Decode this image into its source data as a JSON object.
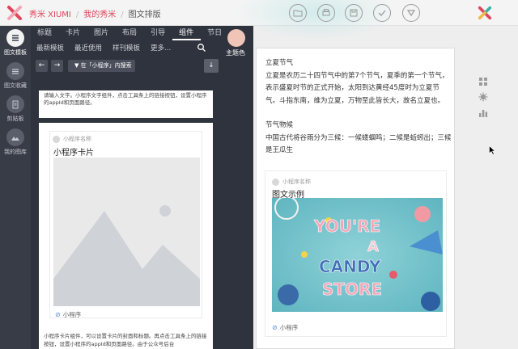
{
  "header": {
    "breadcrumbs": [
      "秀米 XIUMI",
      "我的秀米",
      "图文排版"
    ],
    "tools": [
      "folder-icon",
      "print-icon",
      "save-icon",
      "check-icon",
      "download-icon"
    ]
  },
  "left_nav": [
    {
      "label": "图文模板",
      "icon": "list-icon",
      "active": true
    },
    {
      "label": "图文收藏",
      "icon": "stack-icon",
      "active": false
    },
    {
      "label": "剪贴板",
      "icon": "clipboard-icon",
      "active": false
    },
    {
      "label": "我的图库",
      "icon": "image-icon",
      "active": false
    }
  ],
  "panel": {
    "tabs": [
      {
        "label": "标题",
        "active": false
      },
      {
        "label": "卡片",
        "active": false
      },
      {
        "label": "图片",
        "active": false
      },
      {
        "label": "布局",
        "active": false
      },
      {
        "label": "引导",
        "active": false
      },
      {
        "label": "组件",
        "active": true
      },
      {
        "label": "节日",
        "active": false
      }
    ],
    "subtabs": [
      "最新模板",
      "最近使用",
      "样刊模板",
      "更多..."
    ],
    "theme_label": "主题色",
    "filter_label": "在「小程序」内搜索",
    "prev": "←",
    "next": "→",
    "sort": "↓",
    "card1_text": "请输入文字。小程序文字组件，点击工具条上的链接按钮，设置小程序的appId和页面路径。",
    "card2": {
      "app_name": "小程序名称",
      "title": "小程序卡片",
      "footer": "小程序",
      "desc": "小程序卡片组件，可以设置卡片的封面和标题。再点击工具条上的链接按钮，设置小程序的appId和页面路径。由于公众号后台"
    }
  },
  "article": {
    "para1_title": "立夏节气",
    "para1_body": "立夏是农历二十四节气中的第7个节气，夏季的第一个节气，表示盛夏时节的正式开始，太阳到达黄经45度时为立夏节气。斗指东南，维为立夏，万物至此皆长大，故名立夏也。",
    "para2_title": "节气物候",
    "para2_body": "中国古代将谷雨分为三候：一候蝼蝈鸣；二候是蚯蚓出；三候是王瓜生",
    "card": {
      "app_name": "小程序名称",
      "title": "图文示例",
      "footer": "小程序",
      "photo_text": [
        "YOU'RE",
        "A",
        "CANDY",
        "STORE"
      ]
    }
  },
  "colors": {
    "brand_red": "#e0455a",
    "panel_bg": "#2f333d",
    "nav_bg": "#383c47",
    "theme_swatch": "#f0c4b6",
    "link_blue": "#5c8bd6"
  }
}
